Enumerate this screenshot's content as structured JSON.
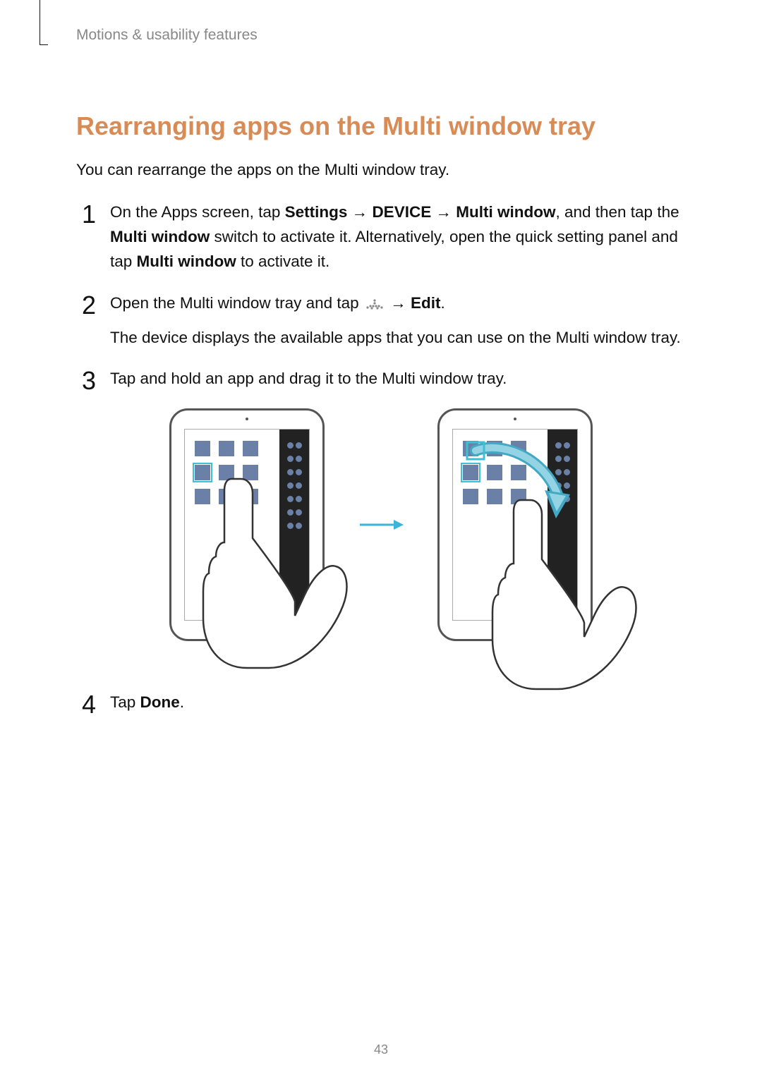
{
  "header": {
    "section": "Motions & usability features"
  },
  "heading": "Rearranging apps on the Multi window tray",
  "intro": "You can rearrange the apps on the Multi window tray.",
  "steps": {
    "s1": {
      "prefix": "On the Apps screen, tap ",
      "path1": "Settings",
      "arrow": " → ",
      "path2": "DEVICE",
      "path3": "Multi window",
      "mid1": ", and then tap the ",
      "bold1": "Multi window",
      "mid2": " switch to activate it. Alternatively, open the quick setting panel and tap ",
      "bold2": "Multi window",
      "suffix": " to activate it."
    },
    "s2": {
      "prefix": "Open the Multi window tray and tap ",
      "arrow": " → ",
      "bold": "Edit",
      "suffix": ".",
      "sub": "The device displays the available apps that you can use on the Multi window tray."
    },
    "s3": {
      "text": "Tap and hold an app and drag it to the Multi window tray."
    },
    "s4": {
      "prefix": "Tap ",
      "bold": "Done",
      "suffix": "."
    }
  },
  "page_number": "43"
}
